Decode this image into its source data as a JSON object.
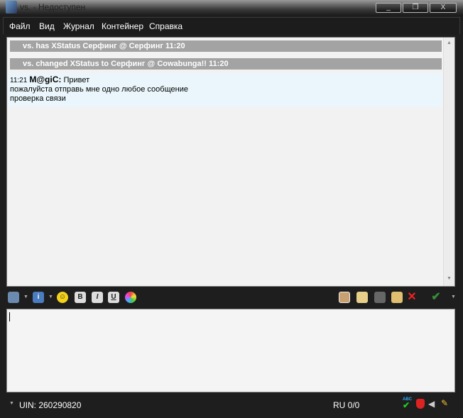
{
  "window": {
    "title": "vs. - Недоступен",
    "min": "_",
    "max": "❐",
    "close": "X"
  },
  "menu": [
    "Файл",
    "Вид",
    "Журнал",
    "Контейнер",
    "Справка"
  ],
  "chat": {
    "events": [
      "vs. has XStatus Серфинг @ Серфинг 11:20",
      "vs. changed XStatus to Серфинг @ Cowabunga!! 11:20"
    ],
    "message": {
      "time": "11:21",
      "sender": "M@giC:",
      "lines": [
        "Привет",
        "пожалуйста отправь мне одно любое сообщение",
        "проверка связи"
      ]
    }
  },
  "toolbar": {
    "bold": "B",
    "italic": "I",
    "underline": "U"
  },
  "input": {
    "value": ""
  },
  "status": {
    "uin": "UIN: 260290820",
    "lang": "RU 0/0",
    "spell": "ABC"
  }
}
